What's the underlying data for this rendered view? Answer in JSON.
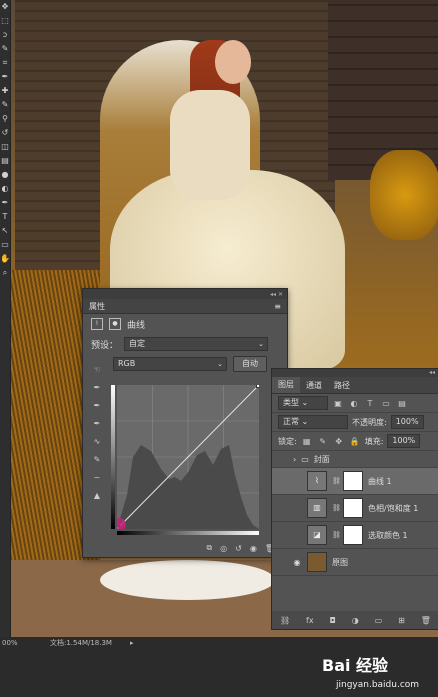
{
  "toolbar": {
    "tools": [
      "move-icon",
      "marquee-icon",
      "lasso-icon",
      "quick-select-icon",
      "crop-icon",
      "eyedropper-icon",
      "healing-icon",
      "brush-icon",
      "clone-stamp-icon",
      "history-brush-icon",
      "eraser-icon",
      "gradient-icon",
      "blur-icon",
      "dodge-icon",
      "pen-icon",
      "type-icon",
      "path-select-icon",
      "shape-icon",
      "hand-icon",
      "zoom-icon"
    ],
    "tool_glyphs": [
      "✥",
      "⬚",
      "ↄ",
      "✎",
      "⌗",
      "✒",
      "✚",
      "✎",
      "⚲",
      "↺",
      "◫",
      "▤",
      "●",
      "◐",
      "✒",
      "T",
      "↖",
      "▭",
      "✋",
      "⌕"
    ]
  },
  "properties": {
    "tab_label": "属性",
    "panel_type": "曲线",
    "preset_label": "预设：",
    "preset_value": "自定",
    "channel_value": "RGB",
    "auto_button": "自动",
    "side_tool_icons": [
      "on-image-adjust-icon",
      "black-point-eyedropper-icon",
      "gray-point-eyedropper-icon",
      "white-point-eyedropper-icon",
      "curve-point-icon",
      "pencil-icon",
      "smooth-icon",
      "clipping-warning-icon"
    ],
    "side_tool_glyphs": [
      "☜",
      "✒",
      "✒",
      "✒",
      "∿",
      "✎",
      "~",
      "▲"
    ],
    "footer_icons": [
      "clip-layer-icon",
      "view-previous-icon",
      "reset-icon",
      "visibility-icon",
      "delete-icon"
    ],
    "footer_glyphs": [
      "⧉",
      "◎",
      "↺",
      "◉",
      "🗑"
    ]
  },
  "layers_panel": {
    "tabs": [
      "图层",
      "通道",
      "路径"
    ],
    "kind_filter": "类型",
    "blend_mode": "正常",
    "opacity_label": "不透明度:",
    "opacity_value": "100%",
    "lock_label": "锁定:",
    "fill_label": "填充:",
    "fill_value": "100%",
    "layers": [
      {
        "name": "封面",
        "kind": "group"
      },
      {
        "name": "曲线 1",
        "kind": "adjustment",
        "selected": true
      },
      {
        "name": "色相/饱和度 1",
        "kind": "adjustment"
      },
      {
        "name": "选取颜色 1",
        "kind": "adjustment"
      },
      {
        "name": "原图",
        "kind": "image"
      }
    ],
    "footer_icons": [
      "link-layers-icon",
      "fx-icon",
      "add-mask-icon",
      "adjustment-layer-icon",
      "group-icon",
      "new-layer-icon",
      "delete-layer-icon"
    ],
    "footer_glyphs": [
      "⛓",
      "fx",
      "◘",
      "◑",
      "▭",
      "⊞",
      "🗑"
    ]
  },
  "status_bar": {
    "zoom": "00%",
    "doc_info": "文档:1.54M/18.3M"
  },
  "watermark": {
    "brand": "Bai 经验",
    "url": "jingyan.baidu.com"
  },
  "chart_data": {
    "type": "line",
    "title": "",
    "x": [
      0,
      255
    ],
    "series": [
      {
        "values": [
          0,
          255
        ]
      }
    ],
    "xlim": [
      0,
      255
    ],
    "ylim": [
      0,
      255
    ]
  },
  "accent": "#c8207a"
}
